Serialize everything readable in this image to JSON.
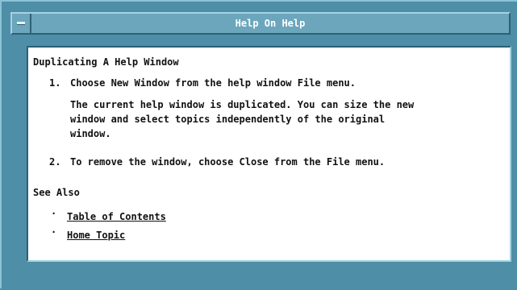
{
  "window": {
    "title": "Help On Help"
  },
  "content": {
    "heading": "Duplicating A Help Window",
    "steps": [
      {
        "number": "1.",
        "text": "Choose New Window from the help window File menu.",
        "note_lines": [
          "The current help window is duplicated. You can size the new",
          "window and select topics independently of the original",
          "window."
        ]
      },
      {
        "number": "2.",
        "text": "To remove the window, choose Close from the File menu."
      }
    ],
    "see_also": {
      "label": "See Also",
      "bullet": "·",
      "links": [
        "Table of Contents",
        "Home Topic"
      ]
    }
  }
}
